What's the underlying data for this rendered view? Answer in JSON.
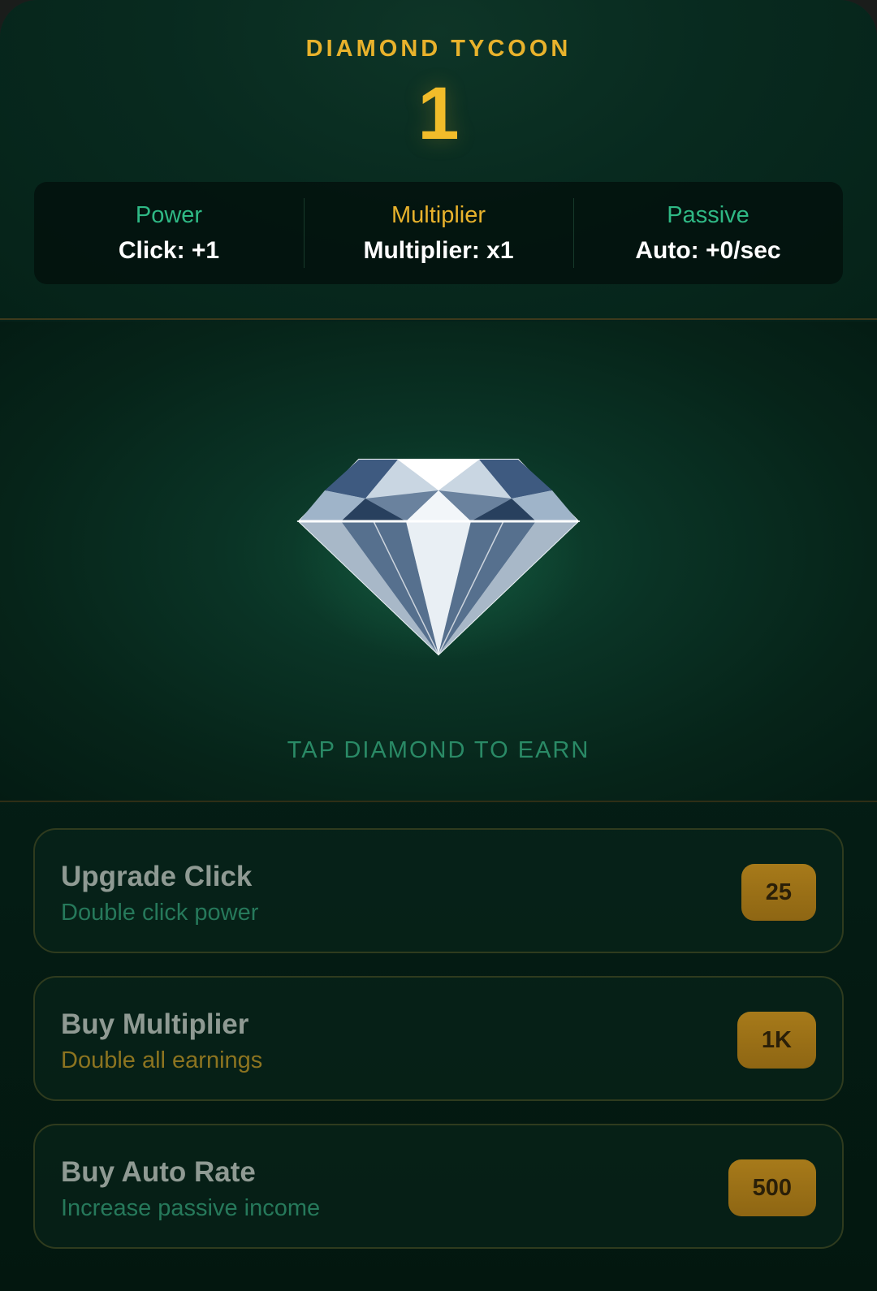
{
  "header": {
    "title": "DIAMOND TYCOON",
    "count": "1"
  },
  "stats": [
    {
      "label": "Power",
      "value": "Click: +1"
    },
    {
      "label": "Multiplier",
      "value": "Multiplier: x1"
    },
    {
      "label": "Passive",
      "value": "Auto: +0/sec"
    }
  ],
  "play": {
    "hint": "TAP DIAMOND TO EARN"
  },
  "upgrades": [
    {
      "title": "Upgrade Click",
      "description": "Double click power",
      "price": "25"
    },
    {
      "title": "Buy Multiplier",
      "description": "Double all earnings",
      "price": "1K"
    },
    {
      "title": "Buy Auto Rate",
      "description": "Increase passive income",
      "price": "500"
    }
  ],
  "colors": {
    "gold": "#f1bc2a",
    "green": "#2fb985",
    "background": "#041d15"
  },
  "icons": {
    "diamond": "diamond-icon"
  }
}
